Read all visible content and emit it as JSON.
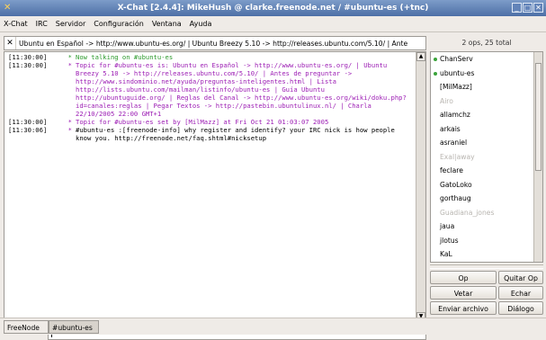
{
  "window": {
    "title": "X-Chat [2.4.4]: MikeHush @ clarke.freenode.net / #ubuntu-es (+tnc)",
    "buttons": [
      "_",
      "□",
      "✕"
    ]
  },
  "menu": [
    "X-Chat",
    "IRC",
    "Servidor",
    "Configuración",
    "Ventana",
    "Ayuda"
  ],
  "topic": {
    "text": "Ubuntu en Español -> http://www.ubuntu-es.org/ | Ubuntu Breezy 5.10 -> http://releases.ubuntu.com/5.10/ | Ante"
  },
  "channel_status": "2 ops, 25 total",
  "messages": [
    {
      "time": "[11:30:00]",
      "nick": "*",
      "text": "Now talking on #ubuntu-es",
      "color": "green"
    },
    {
      "time": "[11:30:00]",
      "nick": "*",
      "text": "Topic for #ubuntu-es is: Ubuntu en Español -> http://www.ubuntu-es.org/ | Ubuntu Breezy 5.10 -> http://releases.ubuntu.com/5.10/ | Antes de preguntar -> http://www.sindominio.net/ayuda/preguntas-inteligentes.html | Lista http://lists.ubuntu.com/mailman/listinfo/ubuntu-es | Guía Ubuntu http://ubuntuguide.org/ | Reglas del Canal -> http://www.ubuntu-es.org/wiki/doku.php?id=canales:reglas | Pegar Textos -> http://pastebin.ubuntulinux.nl/ | Charla 22/10/2005 22:00 GMT+1",
      "color": "purple"
    },
    {
      "time": "[11:30:00]",
      "nick": "*",
      "text": "Topic for #ubuntu-es set by [MilMazz] at Fri Oct 21 01:03:07 2005",
      "color": "purple"
    },
    {
      "time": "[11:30:06]",
      "nick": "*",
      "text": "#ubuntu-es :[freenode-info] why register and identify? your IRC nick is how people know you. http://freenode.net/faq.shtml#nicksetup",
      "color": "black"
    }
  ],
  "users": [
    {
      "name": "ChanServ",
      "op": true,
      "away": false
    },
    {
      "name": "ubuntu-es",
      "op": true,
      "away": false
    },
    {
      "name": "[MilMazz]",
      "op": false,
      "away": false
    },
    {
      "name": "Airo",
      "op": false,
      "away": true
    },
    {
      "name": "allamchz",
      "op": false,
      "away": false
    },
    {
      "name": "arkais",
      "op": false,
      "away": false
    },
    {
      "name": "asraniel",
      "op": false,
      "away": false
    },
    {
      "name": "Exal|away",
      "op": false,
      "away": true
    },
    {
      "name": "feclare",
      "op": false,
      "away": false
    },
    {
      "name": "GatoLoko",
      "op": false,
      "away": false
    },
    {
      "name": "gorthaug",
      "op": false,
      "away": false
    },
    {
      "name": "Guadiana_jones",
      "op": false,
      "away": true
    },
    {
      "name": "jaua",
      "op": false,
      "away": false
    },
    {
      "name": "jlotus",
      "op": false,
      "away": false
    },
    {
      "name": "KaL",
      "op": false,
      "away": false
    }
  ],
  "user_buttons": {
    "op": "Op",
    "quitar_op": "Quitar Op",
    "vetar": "Vetar",
    "echar": "Echar",
    "enviar_archivo": "Enviar archivo",
    "dialogo": "Diálogo"
  },
  "input": {
    "nick": "MikeHush",
    "value": ""
  },
  "tabs": [
    {
      "label": "FreeNode",
      "active": false
    },
    {
      "label": "#ubuntu-es",
      "active": true
    }
  ],
  "colors": {
    "green": "#2d9a2d",
    "purple": "#9c1db4",
    "titlebar": "#5f80b6"
  }
}
